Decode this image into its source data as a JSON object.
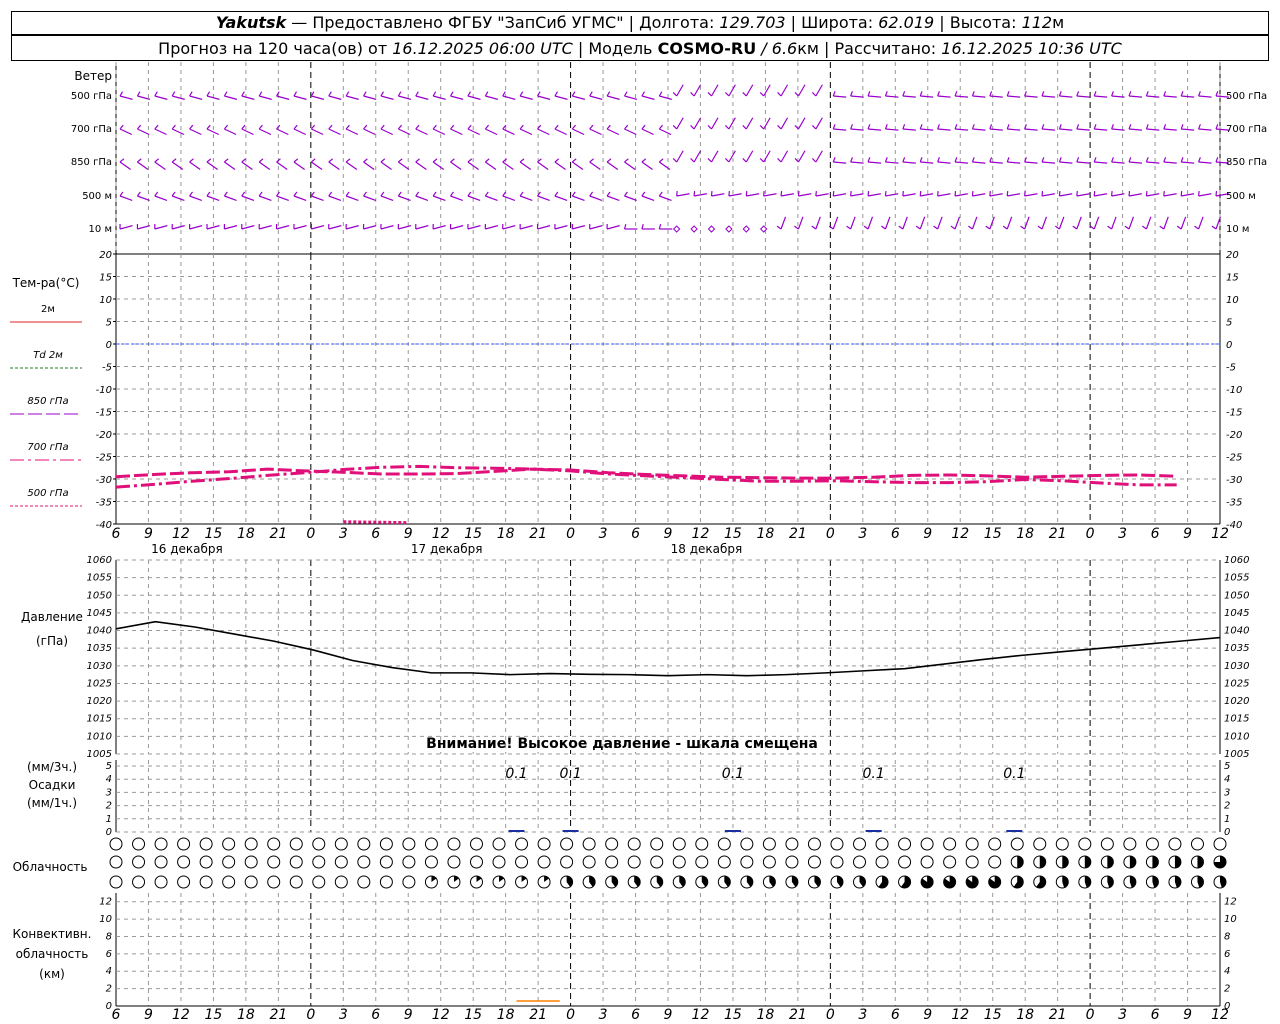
{
  "header": {
    "station": "Yakutsk",
    "provider": " — Предоставлено ФГБУ \"ЗапСиб УГМС\" | Долгота: ",
    "lon": "129.703",
    "lat_label": " | Широта: ",
    "lat": "62.019",
    "alt_label": " | Высота: ",
    "alt": "112",
    "alt_unit": "м",
    "forecast_label": "Прогноз на 120 часа(ов) от ",
    "forecast_time": "16.12.2025 06:00 UTC",
    "model_label": "  | Модель ",
    "model": "COSMO-RU",
    "model_res": " / 6.6",
    "model_unit": "км",
    "calc_label": " | Рассчитано: ",
    "calc_time": "16.12.2025 10:36 UTC"
  },
  "labels": {
    "wind": "Ветер",
    "wind_levels": [
      "500 гПа",
      "700 гПа",
      "850 гПа",
      "500 м",
      "10 м"
    ],
    "temp_title": "Тем-ра(°С)",
    "temp_legend": [
      "2м",
      "Td  2м",
      "850 гПа",
      "700 гПа",
      "500 гПа"
    ],
    "pressure_title": "Давление",
    "pressure_unit": "(гПа)",
    "warning": "Внимание! Высокое давление - шкала смещена",
    "precip_unit1": "(мм/3ч.)",
    "precip_title": "Осадки",
    "precip_unit2": "(мм/1ч.)",
    "cloud_title": "Облачность",
    "conv_title1": "Конвективн.",
    "conv_title2": "облачность",
    "conv_unit": "(км)"
  },
  "colors": {
    "wind": "#9900cc",
    "temp": "#e0107a",
    "zero_line": "#3355ff",
    "pressure": "#000000",
    "precip": "#1a2fa0",
    "convective": "#ff8000",
    "grid": "#999999"
  },
  "chart_data": [
    {
      "type": "line",
      "title": "Temperature",
      "x_hours": [
        6,
        9,
        12,
        15,
        18,
        21,
        24,
        27,
        30,
        33,
        36,
        39,
        42,
        45,
        48,
        51,
        54,
        57,
        60,
        63,
        66,
        69,
        72,
        75,
        78,
        81,
        84,
        87,
        90,
        93,
        96,
        99,
        102,
        105,
        108
      ],
      "time_labels": [
        "6",
        "9",
        "12",
        "15",
        "18",
        "21",
        "0",
        "3",
        "6",
        "9",
        "12",
        "15",
        "18",
        "21",
        "0",
        "3",
        "6",
        "9",
        "12",
        "15",
        "18",
        "21",
        "0",
        "3",
        "6",
        "9",
        "12",
        "15",
        "18",
        "21",
        "0",
        "3",
        "6",
        "9",
        "12"
      ],
      "day_labels": [
        {
          "hour": 12,
          "text": "16 декабря"
        },
        {
          "hour": 36,
          "text": "17 декабря"
        },
        {
          "hour": 60,
          "text": "18 декабря"
        }
      ],
      "ylim": [
        -40,
        20
      ],
      "yticks": [
        20,
        15,
        10,
        5,
        0,
        -5,
        -10,
        -15,
        -20,
        -25,
        -30,
        -35,
        -40
      ],
      "series": [
        {
          "name": "700 гПа",
          "dash": "long",
          "values": [
            -29.5,
            -29,
            -28.6,
            -28.4,
            -27.8,
            -28.2,
            -28.5,
            -28.9,
            -28.9,
            -28.8,
            -28.3,
            -27.8,
            -28,
            -28.6,
            -29,
            -29.3,
            -29.6,
            -29.7,
            -29.8,
            -29.8,
            -29.6,
            -29.2,
            -29.1,
            -29.3,
            -29.6,
            -29.4,
            -29.2,
            -29.1,
            -29.4
          ]
        },
        {
          "name": "500 гПа",
          "dash": "dashdot",
          "values": [
            -31.8,
            -31.2,
            -30.5,
            -29.9,
            -29.2,
            -28.6,
            -27.9,
            -27.4,
            -27.2,
            -27.5,
            -27.6,
            -27.8,
            -28.2,
            -28.9,
            -29.3,
            -29.7,
            -30.1,
            -30.5,
            -30.5,
            -30.4,
            -30.6,
            -30.8,
            -30.8,
            -30.6,
            -30.1,
            -30.4,
            -30.9,
            -31.3,
            -31.3
          ]
        },
        {
          "name": "850 гПа",
          "dash": "short",
          "values": [
            -39.5,
            -39.6,
            -39.7
          ]
        }
      ],
      "series_850_start_hour": 27
    },
    {
      "type": "line",
      "title": "Давление",
      "ylabel": "(гПа)",
      "ylim": [
        1005,
        1060
      ],
      "yticks": [
        1060,
        1055,
        1050,
        1045,
        1040,
        1035,
        1030,
        1025,
        1020,
        1015,
        1010,
        1005
      ],
      "x_hours": [
        6,
        9,
        12,
        15,
        18,
        21,
        24,
        27,
        30,
        33,
        36,
        39,
        42,
        45,
        48,
        51,
        54,
        57,
        60,
        63,
        66,
        69,
        72,
        75,
        78,
        81,
        84,
        87,
        90
      ],
      "values": [
        1040.5,
        1042.5,
        1041,
        1039,
        1037,
        1034.5,
        1031.5,
        1029.5,
        1028,
        1028,
        1027.5,
        1027.8,
        1027.6,
        1027.5,
        1027.2,
        1027.5,
        1027.2,
        1027.5,
        1028,
        1028.6,
        1029.2,
        1030.5,
        1031.8,
        1033,
        1034,
        1035,
        1036,
        1037,
        1038
      ]
    },
    {
      "type": "bar",
      "title": "Осадки",
      "ylim": [
        0,
        5
      ],
      "yticks": [
        5,
        4,
        3,
        2,
        1,
        0
      ],
      "bars": [
        {
          "hour": 39,
          "value": 0.1,
          "label": "0.1"
        },
        {
          "hour": 42,
          "value": 0.1,
          "label": "0.1"
        },
        {
          "hour": 51,
          "value": 0.1,
          "label": "0.1"
        },
        {
          "hour": 60,
          "value": 0.1,
          "label": "0.1"
        },
        {
          "hour": 75,
          "value": 0.1,
          "label": "0.1"
        }
      ]
    },
    {
      "type": "area",
      "title": "Конвективн. облачность",
      "ylim": [
        0,
        13
      ],
      "yticks": [
        12,
        10,
        8,
        6,
        4,
        2,
        0
      ],
      "segments": [
        {
          "from_hour": 39,
          "to_hour": 45,
          "value": 0.5
        }
      ]
    }
  ],
  "cloud_rows": {
    "count": 50,
    "rows": [
      {
        "name": "upper",
        "filled_from": 999
      },
      {
        "name": "middle",
        "half_from": 40,
        "dark_last": true
      },
      {
        "name": "low",
        "quarter_from": 14,
        "heavy_range": [
          34,
          42
        ]
      }
    ]
  }
}
